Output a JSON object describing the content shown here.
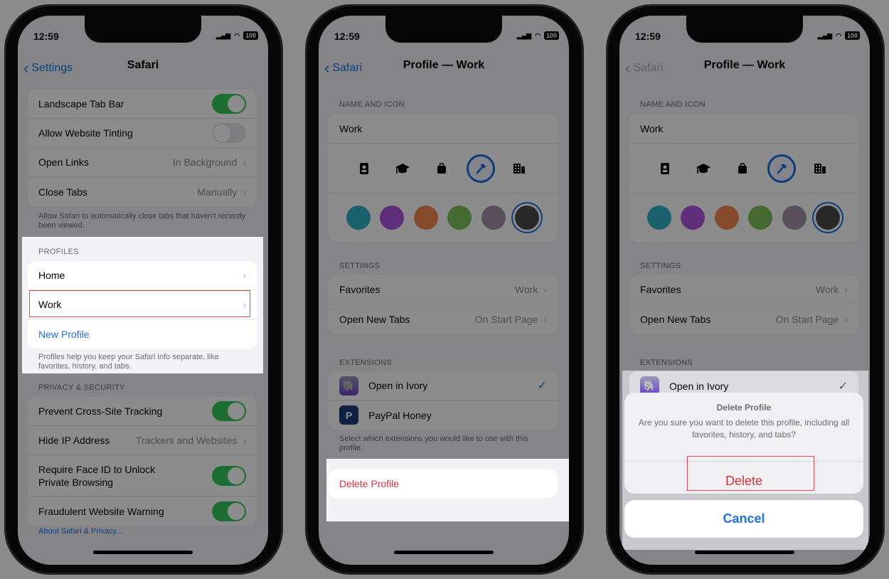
{
  "status": {
    "time": "12:59",
    "battery": "100"
  },
  "screen1": {
    "nav": {
      "back": "Settings",
      "title": "Safari"
    },
    "tabs_group": [
      {
        "label": "Landscape Tab Bar",
        "toggle": true
      },
      {
        "label": "Allow Website Tinting",
        "toggle": false
      },
      {
        "label": "Open Links",
        "value": "In Background"
      },
      {
        "label": "Close Tabs",
        "value": "Manually"
      }
    ],
    "tabs_footer": "Allow Safari to automatically close tabs that haven't recently been viewed.",
    "profiles": {
      "header": "PROFILES",
      "items": [
        "Home",
        "Work"
      ],
      "new_profile": "New Profile",
      "footer": "Profiles help you keep your Safari info separate, like favorites, history, and tabs."
    },
    "privacy": {
      "header": "PRIVACY & SECURITY",
      "items": [
        {
          "label": "Prevent Cross-Site Tracking",
          "toggle": true
        },
        {
          "label": "Hide IP Address",
          "value": "Trackers and Websites"
        },
        {
          "label": "Require Face ID to Unlock Private Browsing",
          "toggle": true
        },
        {
          "label": "Fraudulent Website Warning",
          "toggle": true
        }
      ],
      "about_link": "About Safari & Privacy..."
    }
  },
  "profile": {
    "nav": {
      "back": "Safari",
      "title": "Profile — Work"
    },
    "name_header": "NAME AND ICON",
    "name": "Work",
    "icons": [
      "person-badge-icon",
      "graduation-cap-icon",
      "briefcase-icon",
      "hammer-icon",
      "building-icon"
    ],
    "selected_icon": "hammer-icon",
    "colors": [
      "#30b0c7",
      "#af52de",
      "#f2874f",
      "#7cc05a",
      "#a08fa8",
      "#4a4a4a"
    ],
    "selected_color": "#4a4a4a",
    "settings_header": "SETTINGS",
    "settings": [
      {
        "label": "Favorites",
        "value": "Work"
      },
      {
        "label": "Open New Tabs",
        "value": "On Start Page"
      }
    ],
    "extensions_header": "EXTENSIONS",
    "extensions": [
      {
        "label": "Open in Ivory",
        "checked": true
      },
      {
        "label": "PayPal Honey",
        "checked": false
      }
    ],
    "extensions_footer": "Select which extensions you would like to use with this profile.",
    "delete_label": "Delete Profile"
  },
  "dialog": {
    "title": "Delete Profile",
    "message": "Are you sure you want to delete this profile, including all favorites, history, and tabs?",
    "delete": "Delete",
    "cancel": "Cancel"
  },
  "colors": {
    "accent": "#1a73e8",
    "destructive": "#e0303a",
    "highlight_box": "#e0455a",
    "toggle_on": "#34c759"
  }
}
